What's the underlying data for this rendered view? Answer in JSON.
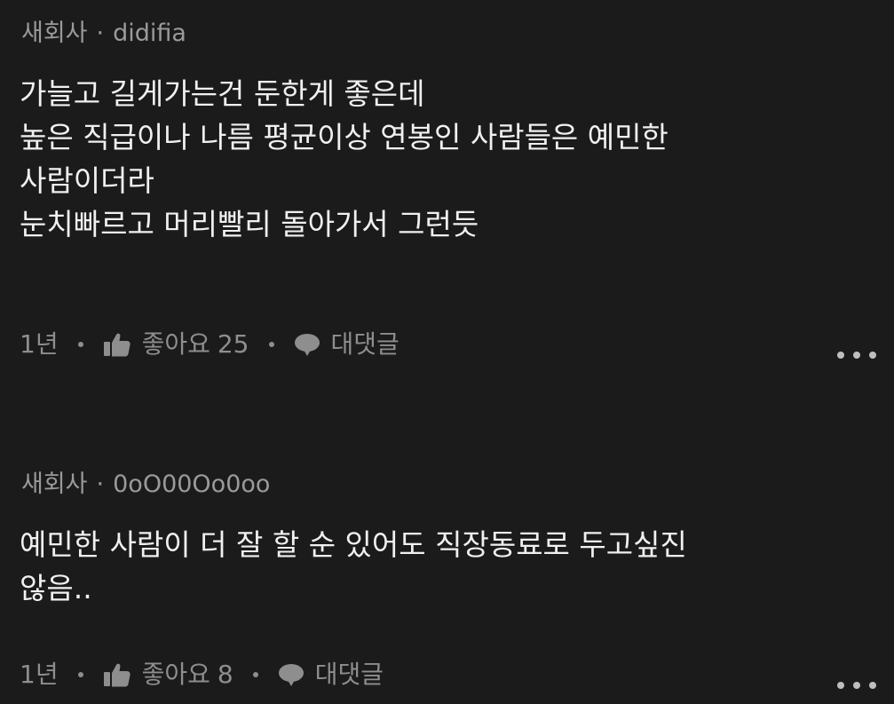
{
  "comments": [
    {
      "company": "새회사",
      "author": "didifia",
      "lines": [
        "가늘고 길게가는건 둔한게 좋은데",
        "높은 직급이나 나름 평균이상 연봉인 사람들은 예민한",
        "사람이더라",
        "눈치빠르고 머리빨리 돌아가서 그런듯"
      ],
      "time": "1년",
      "like_label": "좋아요",
      "like_count": "25",
      "reply_label": "대댓글"
    },
    {
      "company": "새회사",
      "author": "0oO00Oo0oo",
      "lines": [
        "예민한 사람이 더 잘 할 순 있어도 직장동료로 두고싶진",
        "않음.."
      ],
      "time": "1년",
      "like_label": "좋아요",
      "like_count": "8",
      "reply_label": "대댓글"
    }
  ],
  "icons": {
    "like": "thumbs-up-icon",
    "reply": "speech-bubble-icon",
    "more": "more-dots-icon"
  },
  "colors": {
    "background": "#1b1b1b",
    "text": "#f0f0f0",
    "muted": "#8e8e8e"
  }
}
